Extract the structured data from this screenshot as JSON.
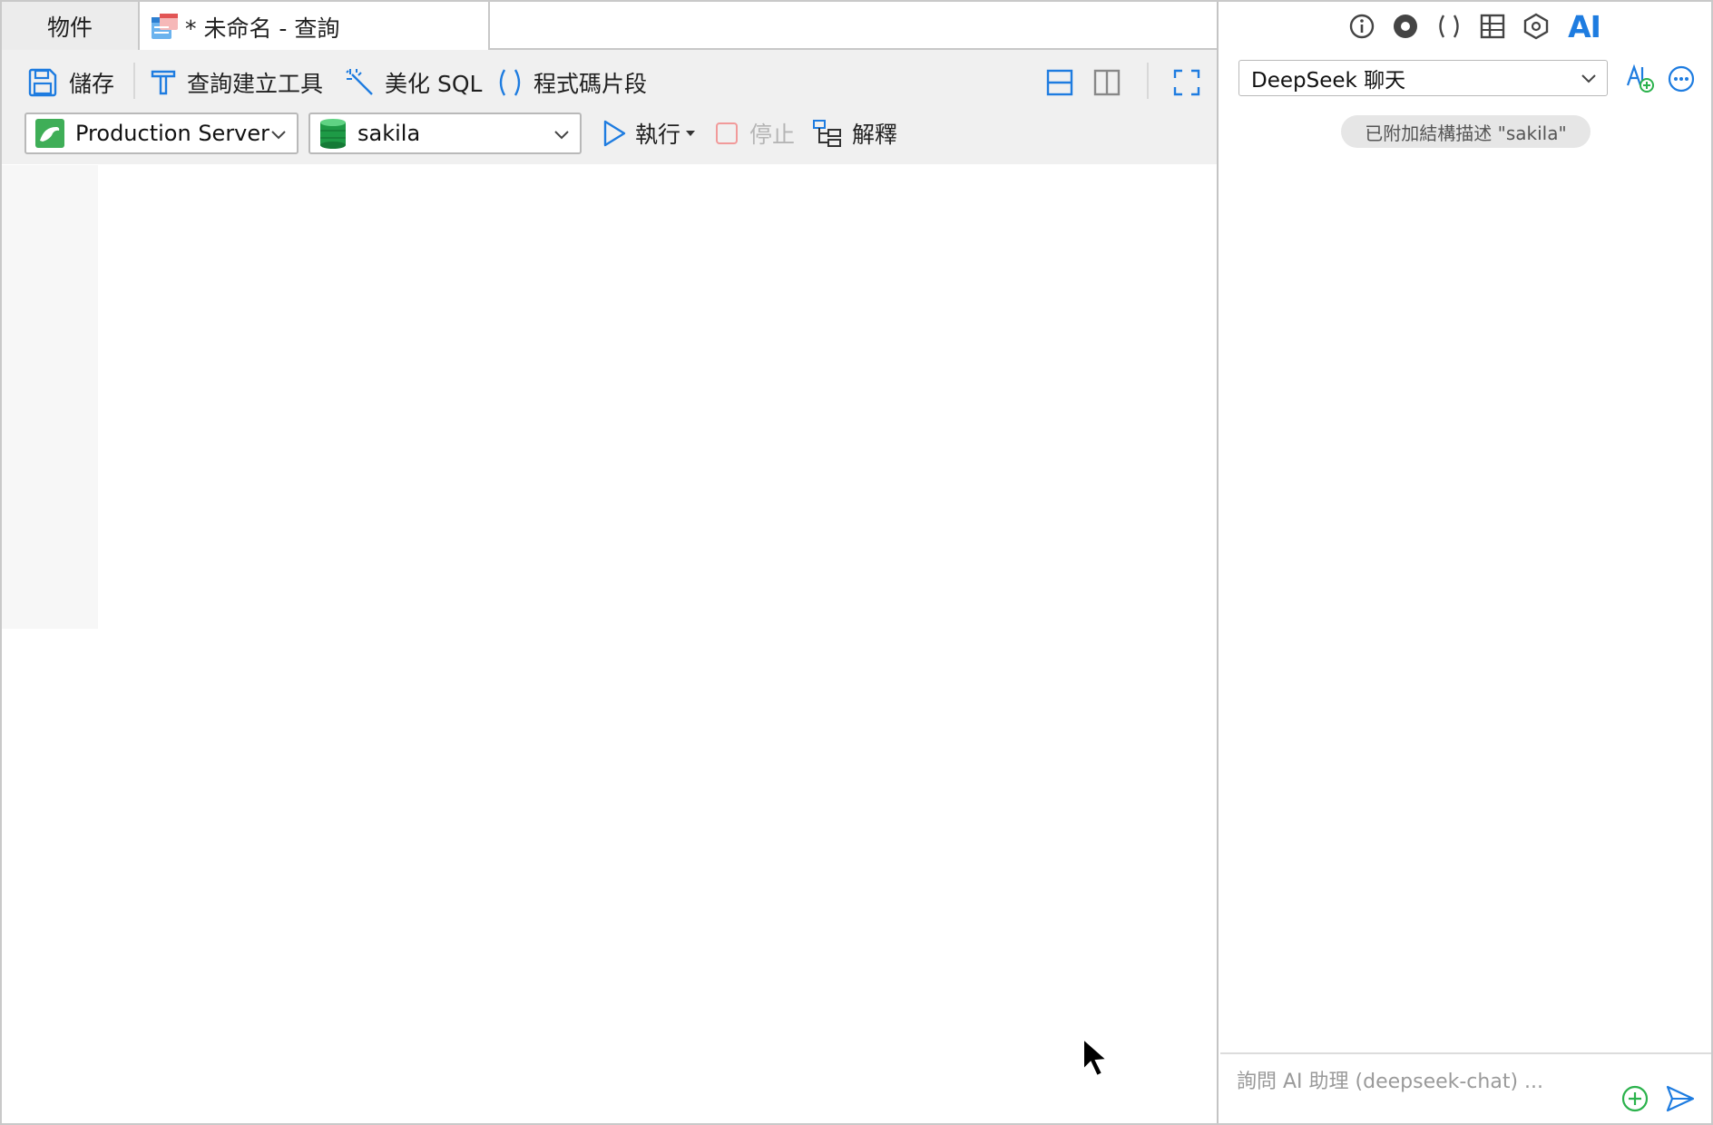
{
  "tabs": {
    "objects": "物件",
    "query": "* 未命名 - 查詢"
  },
  "toolbar": {
    "save": "儲存",
    "query_builder": "查詢建立工具",
    "beautify": "美化 SQL",
    "snippets": "程式碼片段",
    "run": "執行",
    "stop": "停止",
    "explain": "解釋"
  },
  "connection": {
    "selected": "Production Server"
  },
  "database": {
    "selected": "sakila"
  },
  "ai_panel": {
    "ai_label": "AI",
    "model": "DeepSeek 聊天",
    "schema_chip": "已附加結構描述 \"sakila\"",
    "input_placeholder": "詢問 AI 助理 (deepseek-chat) ..."
  },
  "colors": {
    "accent_blue": "#1e7ce0",
    "toolbar_bg": "#f0f0f0",
    "stop_disabled": "#f19a9a",
    "add_green": "#2bb24c"
  }
}
